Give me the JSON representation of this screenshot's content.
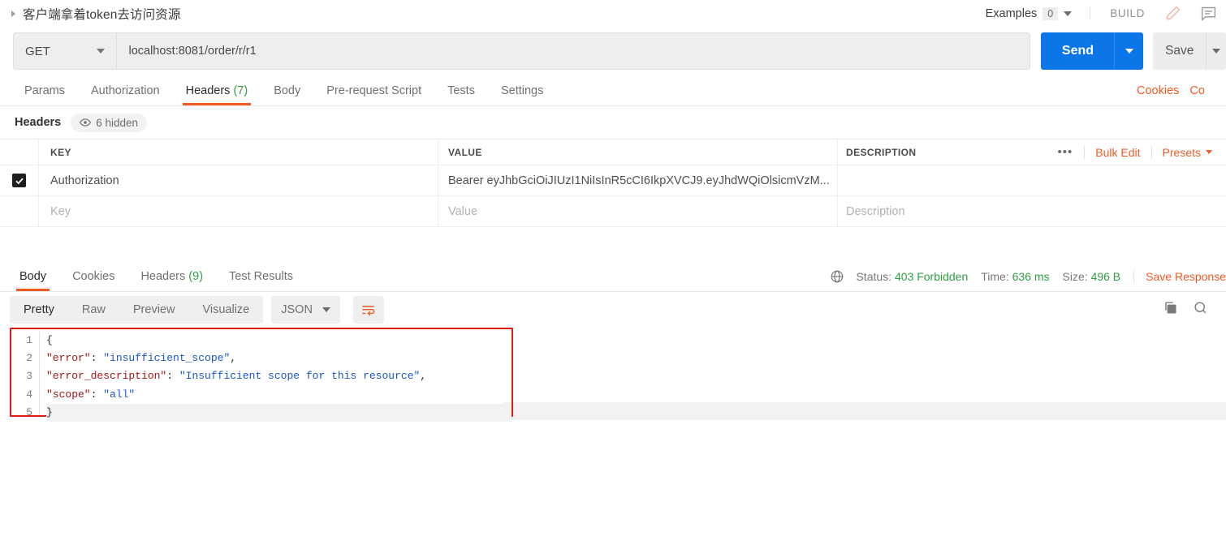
{
  "titlebar": {
    "request_name": "客户端拿着token去访问资源",
    "examples_label": "Examples",
    "examples_count": "0",
    "build_label": "BUILD",
    "edit_icon": "pencil-icon",
    "comment_icon": "comment-icon",
    "disclosure_icon": "disclosure-triangle-icon"
  },
  "urlbar": {
    "method": "GET",
    "url": "localhost:8081/order/r/r1",
    "send_label": "Send",
    "save_label": "Save"
  },
  "request_tabs": {
    "items": [
      {
        "label": "Params",
        "count": "",
        "active": false
      },
      {
        "label": "Authorization",
        "count": "",
        "active": false
      },
      {
        "label": "Headers",
        "count": "(7)",
        "active": true
      },
      {
        "label": "Body",
        "count": "",
        "active": false
      },
      {
        "label": "Pre-request Script",
        "count": "",
        "active": false
      },
      {
        "label": "Tests",
        "count": "",
        "active": false
      },
      {
        "label": "Settings",
        "count": "",
        "active": false
      }
    ],
    "cookies_label": "Cookies",
    "code_label": "Co"
  },
  "headers_section": {
    "title": "Headers",
    "hidden_badge": "6 hidden",
    "eye_icon": "eye-icon",
    "columns": [
      "KEY",
      "VALUE",
      "DESCRIPTION"
    ],
    "actions": {
      "more_label": "•••",
      "bulk_edit_label": "Bulk Edit",
      "presets_label": "Presets"
    },
    "rows": [
      {
        "checked": true,
        "key": "Authorization",
        "value": "Bearer eyJhbGciOiJIUzI1NiIsInR5cCI6IkpXVCJ9.eyJhdWQiOlsicmVzM...",
        "description": ""
      }
    ],
    "placeholder_row": {
      "key": "Key",
      "value": "Value",
      "description": "Description"
    }
  },
  "response": {
    "tabs": [
      {
        "label": "Body",
        "count": "",
        "active": true
      },
      {
        "label": "Cookies",
        "count": "",
        "active": false
      },
      {
        "label": "Headers",
        "count": "(9)",
        "active": false
      },
      {
        "label": "Test Results",
        "count": "",
        "active": false
      }
    ],
    "globe_icon": "globe-icon",
    "status_label": "Status:",
    "status_value": "403 Forbidden",
    "time_label": "Time:",
    "time_value": "636 ms",
    "size_label": "Size:",
    "size_value": "496 B",
    "save_response_label": "Save Response",
    "toolbar": {
      "views": [
        {
          "label": "Pretty",
          "active": true
        },
        {
          "label": "Raw",
          "active": false
        },
        {
          "label": "Preview",
          "active": false
        },
        {
          "label": "Visualize",
          "active": false
        }
      ],
      "format": "JSON",
      "wrap_icon": "wrap-lines-icon",
      "copy_icon": "copy-icon",
      "search_icon": "search-icon"
    },
    "body_lines": [
      {
        "n": "1",
        "tokens": [
          {
            "t": "p",
            "v": "{"
          }
        ]
      },
      {
        "n": "2",
        "tokens": [
          {
            "t": "p",
            "v": "    "
          },
          {
            "t": "k",
            "v": "\"error\""
          },
          {
            "t": "p",
            "v": ": "
          },
          {
            "t": "s",
            "v": "\"insufficient_scope\""
          },
          {
            "t": "p",
            "v": ","
          }
        ]
      },
      {
        "n": "3",
        "tokens": [
          {
            "t": "p",
            "v": "    "
          },
          {
            "t": "k",
            "v": "\"error_description\""
          },
          {
            "t": "p",
            "v": ": "
          },
          {
            "t": "s",
            "v": "\"Insufficient scope for this resource\""
          },
          {
            "t": "p",
            "v": ","
          }
        ]
      },
      {
        "n": "4",
        "tokens": [
          {
            "t": "p",
            "v": "    "
          },
          {
            "t": "k",
            "v": "\"scope\""
          },
          {
            "t": "p",
            "v": ": "
          },
          {
            "t": "s",
            "v": "\"all\""
          }
        ]
      },
      {
        "n": "5",
        "tokens": [
          {
            "t": "p",
            "v": "}"
          }
        ]
      }
    ]
  },
  "colors": {
    "accent_orange": "#ef5b25",
    "send_blue": "#0c75e8",
    "status_green": "#2ea043",
    "highlight_red": "#e01919"
  }
}
